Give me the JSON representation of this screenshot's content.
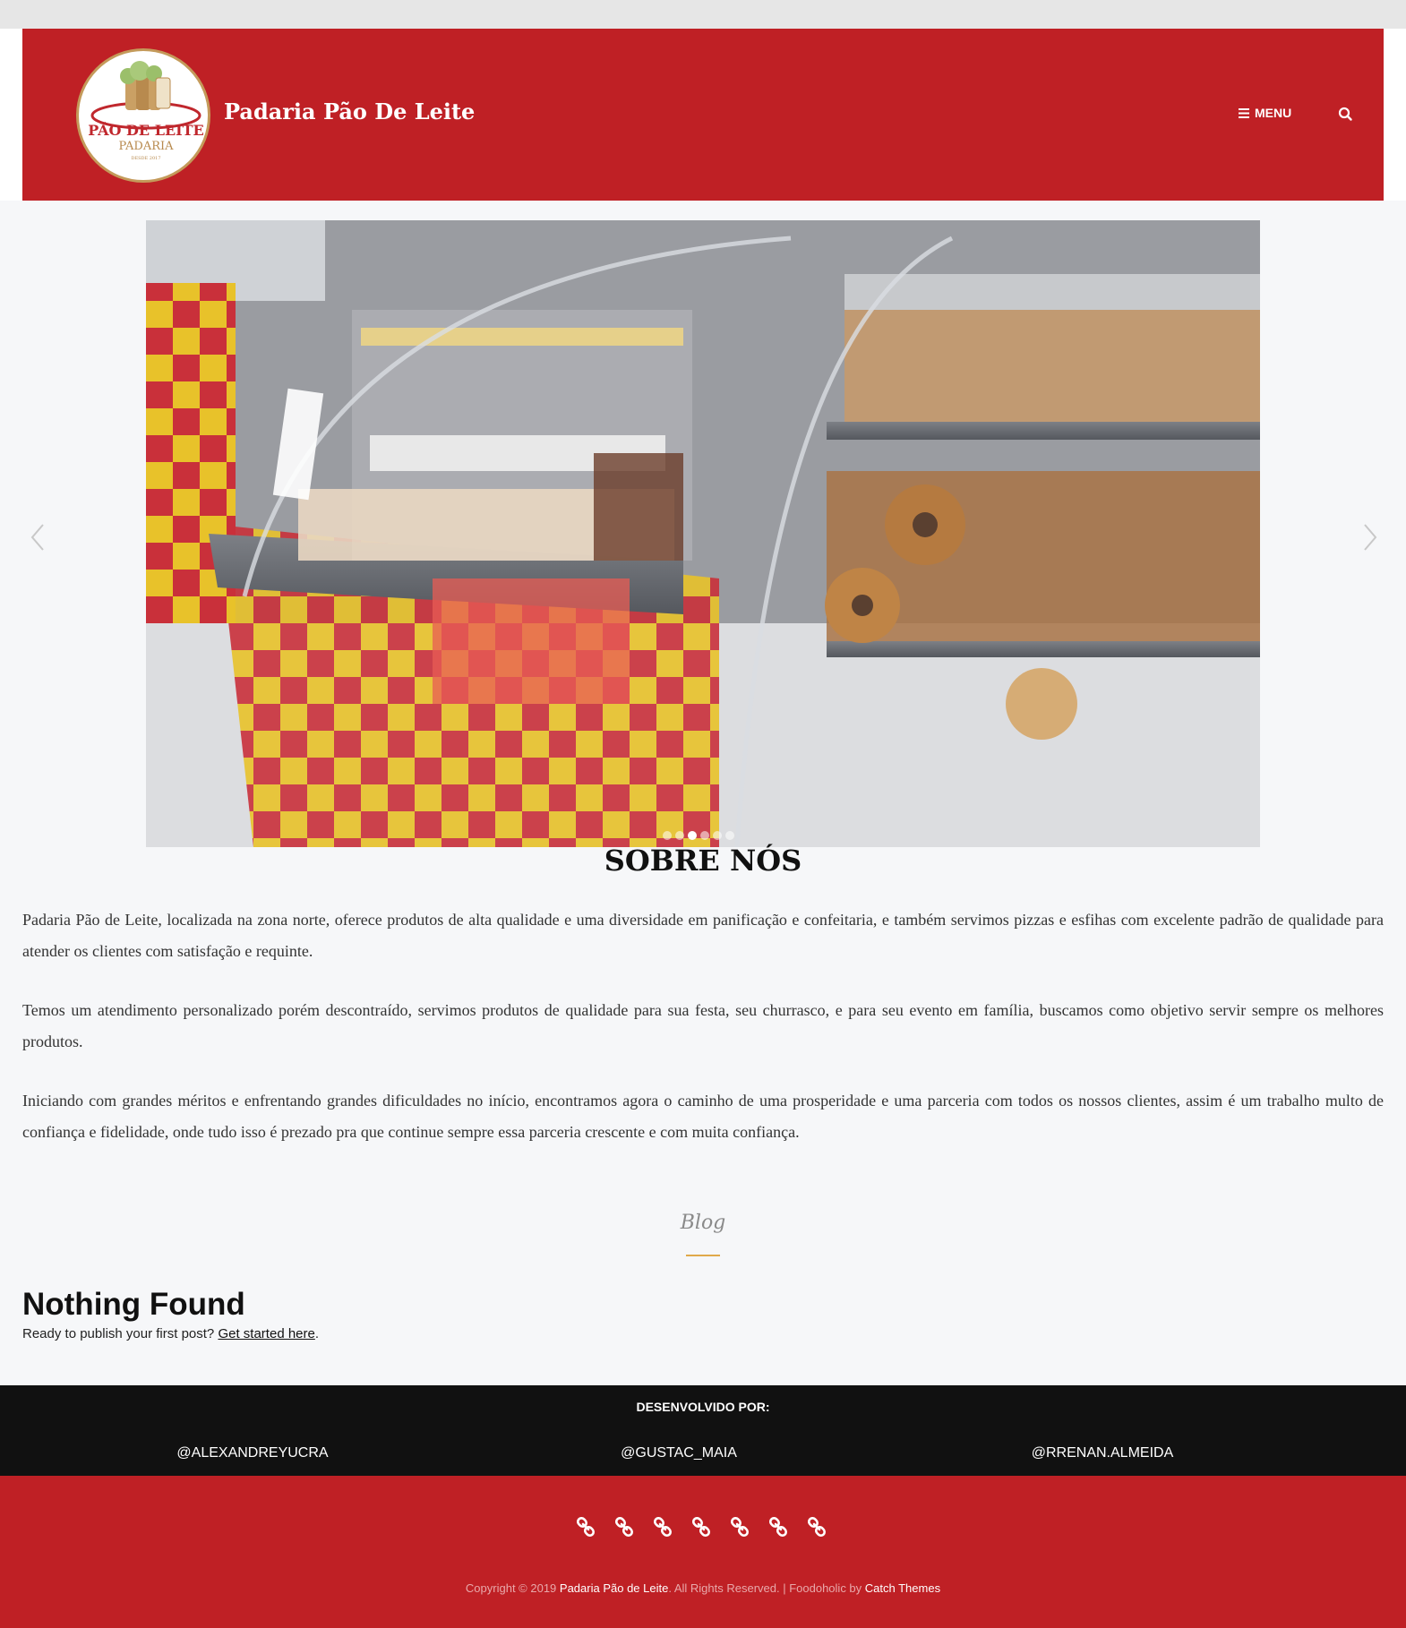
{
  "header": {
    "site_title": "Padaria Pão De Leite",
    "menu_label": "MENU",
    "logo": {
      "line1": "PÃO DE LEITE",
      "line2": "PADARIA",
      "line3": "DESDE 2017"
    }
  },
  "slider": {
    "slide_count": 6,
    "active_index": 2
  },
  "about": {
    "title": "SOBRE NÓS",
    "paragraphs": [
      "Padaria Pão de Leite, localizada na zona norte, oferece produtos de alta qualidade e uma diversidade em panificação e confeitaria, e também servimos pizzas e esfihas com excelente padrão de qualidade para atender os clientes com satisfação e requinte.",
      "Temos um atendimento personalizado porém descontraído, servimos produtos de qualidade para sua festa, seu churrasco, e para seu evento em família, buscamos como objetivo servir sempre os melhores produtos.",
      "Iniciando com grandes méritos e enfrentando grandes dificuldades no início, encontramos agora o caminho de uma prosperidade e uma parceria com todos os nossos clientes, assim é um trabalho multo de confiança e fidelidade, onde tudo isso é prezado pra que continue sempre essa parceria crescente e com muita confiança."
    ]
  },
  "blog": {
    "label": "Blog",
    "heading": "Nothing Found",
    "prompt": "Ready to publish your first post?",
    "link": "Get started here",
    "period": "."
  },
  "developers": {
    "title": "DESENVOLVIDO POR:",
    "names": [
      "@ALEXANDREYUCRA",
      "@GUSTAC_MAIA",
      "@RRENAN.ALMEIDA"
    ]
  },
  "footer": {
    "social_icon_count": 7,
    "copyright_prefix": "Copyright © 2019 ",
    "copyright_site": "Padaria Pão de Leite",
    "copyright_middle": ". All Rights Reserved. | Foodoholic by ",
    "copyright_theme": "Catch Themes"
  },
  "colors": {
    "brand_red": "#bf2025",
    "dark_bar": "#111111",
    "accent_gold": "#e0a94a",
    "page_bg": "#f6f7f9"
  }
}
